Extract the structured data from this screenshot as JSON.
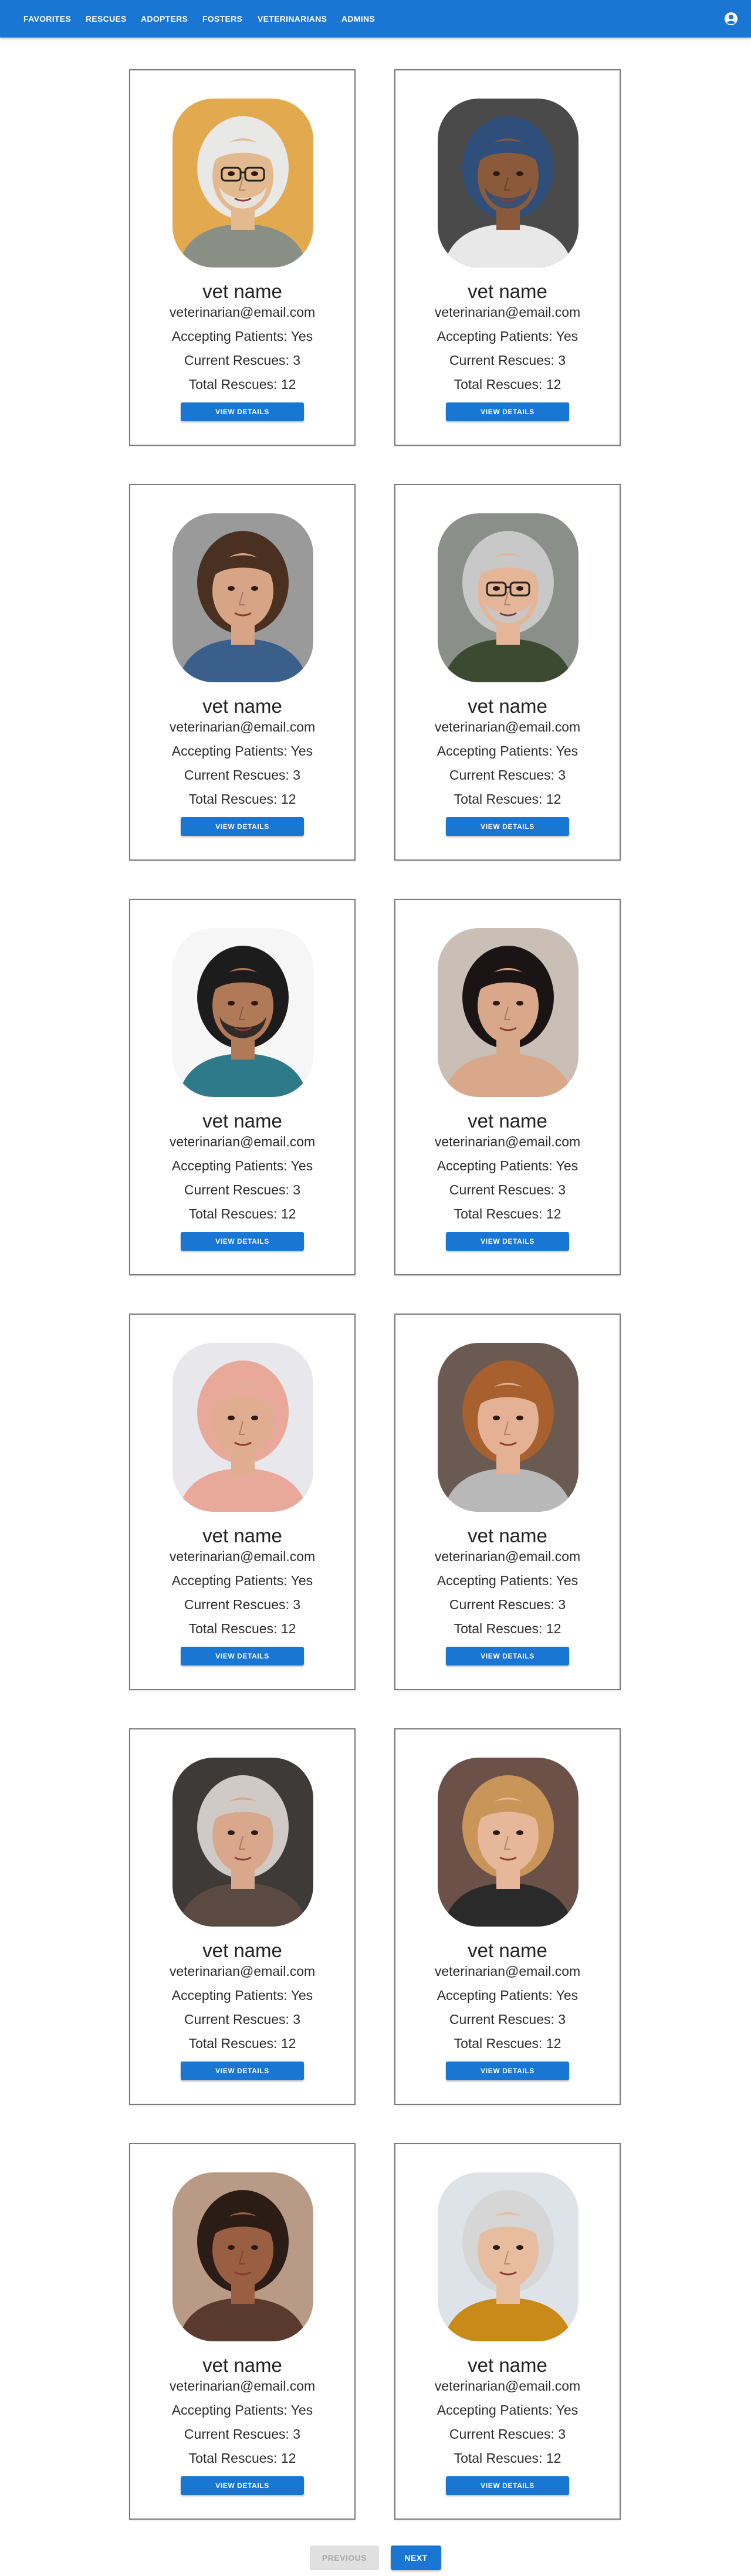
{
  "nav": {
    "links": [
      "FAVORITES",
      "RESCUES",
      "ADOPTERS",
      "FOSTERS",
      "VETERINARIANS",
      "ADMINS"
    ],
    "account_icon": "account-circle-icon"
  },
  "vets": [
    {
      "name": "vet name",
      "email": "veterinarian@email.com",
      "accepting": "Accepting Patients: Yes",
      "current": "Current Rescues: 3",
      "total": "Total Rescues: 12",
      "button": "VIEW DETAILS",
      "photo": {
        "bg": "#e3a94e",
        "skin": "#e3b98f",
        "hair": "#e8e8e6",
        "clothes": "#8a8f86",
        "glasses": true,
        "beard": true
      }
    },
    {
      "name": "vet name",
      "email": "veterinarian@email.com",
      "accepting": "Accepting Patients: Yes",
      "current": "Current Rescues: 3",
      "total": "Total Rescues: 12",
      "button": "VIEW DETAILS",
      "photo": {
        "bg": "#4a4a4a",
        "skin": "#8a5a3a",
        "hair": "#2f4f7a",
        "clothes": "#e8e8e8",
        "glasses": false,
        "beard": true
      }
    },
    {
      "name": "vet name",
      "email": "veterinarian@email.com",
      "accepting": "Accepting Patients: Yes",
      "current": "Current Rescues: 3",
      "total": "Total Rescues: 12",
      "button": "VIEW DETAILS",
      "photo": {
        "bg": "#9a9a9a",
        "skin": "#d7a586",
        "hair": "#4a3020",
        "clothes": "#3a5f8a",
        "glasses": false,
        "beard": false
      }
    },
    {
      "name": "vet name",
      "email": "veterinarian@email.com",
      "accepting": "Accepting Patients: Yes",
      "current": "Current Rescues: 3",
      "total": "Total Rescues: 12",
      "button": "VIEW DETAILS",
      "photo": {
        "bg": "#8a8f8a",
        "skin": "#e4b597",
        "hair": "#c8c8c8",
        "clothes": "#3c4a32",
        "glasses": true,
        "beard": true
      }
    },
    {
      "name": "vet name",
      "email": "veterinarian@email.com",
      "accepting": "Accepting Patients: Yes",
      "current": "Current Rescues: 3",
      "total": "Total Rescues: 12",
      "button": "VIEW DETAILS",
      "photo": {
        "bg": "#f6f6f6",
        "skin": "#b07a58",
        "hair": "#1c1c1c",
        "clothes": "#2f7a8a",
        "glasses": false,
        "beard": true
      }
    },
    {
      "name": "vet name",
      "email": "veterinarian@email.com",
      "accepting": "Accepting Patients: Yes",
      "current": "Current Rescues: 3",
      "total": "Total Rescues: 12",
      "button": "VIEW DETAILS",
      "photo": {
        "bg": "#c9bfb6",
        "skin": "#d9a88a",
        "hair": "#1a1414",
        "clothes": "#d9a88a",
        "glasses": false,
        "beard": false
      }
    },
    {
      "name": "vet name",
      "email": "veterinarian@email.com",
      "accepting": "Accepting Patients: Yes",
      "current": "Current Rescues: 3",
      "total": "Total Rescues: 12",
      "button": "VIEW DETAILS",
      "photo": {
        "bg": "#e8e8ec",
        "skin": "#e0ad90",
        "hair": "#e8a89a",
        "clothes": "#e8a89a",
        "glasses": false,
        "beard": false
      }
    },
    {
      "name": "vet name",
      "email": "veterinarian@email.com",
      "accepting": "Accepting Patients: Yes",
      "current": "Current Rescues: 3",
      "total": "Total Rescues: 12",
      "button": "VIEW DETAILS",
      "photo": {
        "bg": "#6a5a52",
        "skin": "#e4b194",
        "hair": "#a8612e",
        "clothes": "#b8b8b8",
        "glasses": false,
        "beard": false
      }
    },
    {
      "name": "vet name",
      "email": "veterinarian@email.com",
      "accepting": "Accepting Patients: Yes",
      "current": "Current Rescues: 3",
      "total": "Total Rescues: 12",
      "button": "VIEW DETAILS",
      "photo": {
        "bg": "#3e3a38",
        "skin": "#d9a78c",
        "hair": "#cfcac6",
        "clothes": "#5a4a42",
        "glasses": false,
        "beard": false
      }
    },
    {
      "name": "vet name",
      "email": "veterinarian@email.com",
      "accepting": "Accepting Patients: Yes",
      "current": "Current Rescues: 3",
      "total": "Total Rescues: 12",
      "button": "VIEW DETAILS",
      "photo": {
        "bg": "#6b5148",
        "skin": "#e6b799",
        "hair": "#c99558",
        "clothes": "#2a2a2a",
        "glasses": false,
        "beard": false
      }
    },
    {
      "name": "vet name",
      "email": "veterinarian@email.com",
      "accepting": "Accepting Patients: Yes",
      "current": "Current Rescues: 3",
      "total": "Total Rescues: 12",
      "button": "VIEW DETAILS",
      "photo": {
        "bg": "#b99a86",
        "skin": "#9a5f43",
        "hair": "#2b1c16",
        "clothes": "#5a3a2e",
        "glasses": false,
        "beard": false
      }
    },
    {
      "name": "vet name",
      "email": "veterinarian@email.com",
      "accepting": "Accepting Patients: Yes",
      "current": "Current Rescues: 3",
      "total": "Total Rescues: 12",
      "button": "VIEW DETAILS",
      "photo": {
        "bg": "#dde3e8",
        "skin": "#e8bd9f",
        "hair": "#d6d6d6",
        "clothes": "#c98a1a",
        "glasses": false,
        "beard": false
      }
    }
  ],
  "pagination": {
    "previous": "PREVIOUS",
    "next": "NEXT"
  }
}
